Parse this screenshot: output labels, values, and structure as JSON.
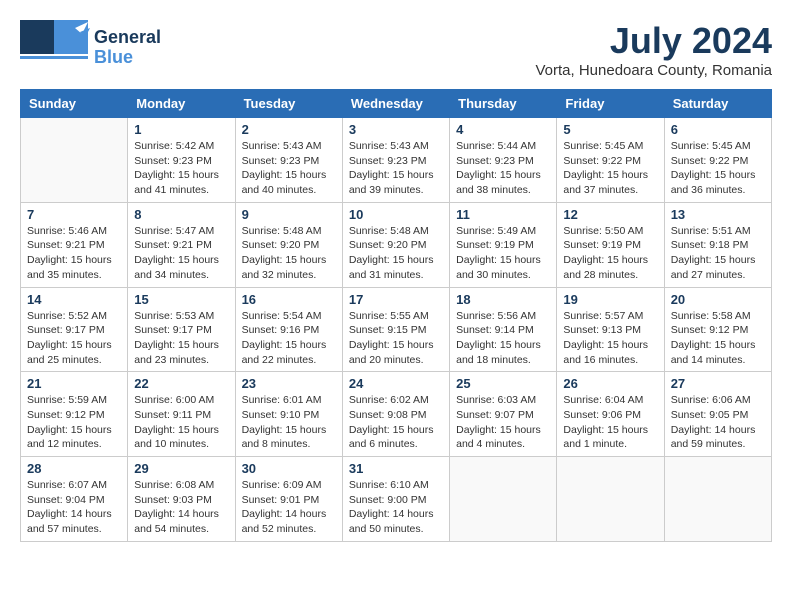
{
  "header": {
    "logo_line1": "General",
    "logo_line2": "Blue",
    "month": "July 2024",
    "location": "Vorta, Hunedoara County, Romania"
  },
  "days_of_week": [
    "Sunday",
    "Monday",
    "Tuesday",
    "Wednesday",
    "Thursday",
    "Friday",
    "Saturday"
  ],
  "weeks": [
    [
      {
        "day": "",
        "sunrise": "",
        "sunset": "",
        "daylight": ""
      },
      {
        "day": "1",
        "sunrise": "Sunrise: 5:42 AM",
        "sunset": "Sunset: 9:23 PM",
        "daylight": "Daylight: 15 hours and 41 minutes."
      },
      {
        "day": "2",
        "sunrise": "Sunrise: 5:43 AM",
        "sunset": "Sunset: 9:23 PM",
        "daylight": "Daylight: 15 hours and 40 minutes."
      },
      {
        "day": "3",
        "sunrise": "Sunrise: 5:43 AM",
        "sunset": "Sunset: 9:23 PM",
        "daylight": "Daylight: 15 hours and 39 minutes."
      },
      {
        "day": "4",
        "sunrise": "Sunrise: 5:44 AM",
        "sunset": "Sunset: 9:23 PM",
        "daylight": "Daylight: 15 hours and 38 minutes."
      },
      {
        "day": "5",
        "sunrise": "Sunrise: 5:45 AM",
        "sunset": "Sunset: 9:22 PM",
        "daylight": "Daylight: 15 hours and 37 minutes."
      },
      {
        "day": "6",
        "sunrise": "Sunrise: 5:45 AM",
        "sunset": "Sunset: 9:22 PM",
        "daylight": "Daylight: 15 hours and 36 minutes."
      }
    ],
    [
      {
        "day": "7",
        "sunrise": "Sunrise: 5:46 AM",
        "sunset": "Sunset: 9:21 PM",
        "daylight": "Daylight: 15 hours and 35 minutes."
      },
      {
        "day": "8",
        "sunrise": "Sunrise: 5:47 AM",
        "sunset": "Sunset: 9:21 PM",
        "daylight": "Daylight: 15 hours and 34 minutes."
      },
      {
        "day": "9",
        "sunrise": "Sunrise: 5:48 AM",
        "sunset": "Sunset: 9:20 PM",
        "daylight": "Daylight: 15 hours and 32 minutes."
      },
      {
        "day": "10",
        "sunrise": "Sunrise: 5:48 AM",
        "sunset": "Sunset: 9:20 PM",
        "daylight": "Daylight: 15 hours and 31 minutes."
      },
      {
        "day": "11",
        "sunrise": "Sunrise: 5:49 AM",
        "sunset": "Sunset: 9:19 PM",
        "daylight": "Daylight: 15 hours and 30 minutes."
      },
      {
        "day": "12",
        "sunrise": "Sunrise: 5:50 AM",
        "sunset": "Sunset: 9:19 PM",
        "daylight": "Daylight: 15 hours and 28 minutes."
      },
      {
        "day": "13",
        "sunrise": "Sunrise: 5:51 AM",
        "sunset": "Sunset: 9:18 PM",
        "daylight": "Daylight: 15 hours and 27 minutes."
      }
    ],
    [
      {
        "day": "14",
        "sunrise": "Sunrise: 5:52 AM",
        "sunset": "Sunset: 9:17 PM",
        "daylight": "Daylight: 15 hours and 25 minutes."
      },
      {
        "day": "15",
        "sunrise": "Sunrise: 5:53 AM",
        "sunset": "Sunset: 9:17 PM",
        "daylight": "Daylight: 15 hours and 23 minutes."
      },
      {
        "day": "16",
        "sunrise": "Sunrise: 5:54 AM",
        "sunset": "Sunset: 9:16 PM",
        "daylight": "Daylight: 15 hours and 22 minutes."
      },
      {
        "day": "17",
        "sunrise": "Sunrise: 5:55 AM",
        "sunset": "Sunset: 9:15 PM",
        "daylight": "Daylight: 15 hours and 20 minutes."
      },
      {
        "day": "18",
        "sunrise": "Sunrise: 5:56 AM",
        "sunset": "Sunset: 9:14 PM",
        "daylight": "Daylight: 15 hours and 18 minutes."
      },
      {
        "day": "19",
        "sunrise": "Sunrise: 5:57 AM",
        "sunset": "Sunset: 9:13 PM",
        "daylight": "Daylight: 15 hours and 16 minutes."
      },
      {
        "day": "20",
        "sunrise": "Sunrise: 5:58 AM",
        "sunset": "Sunset: 9:12 PM",
        "daylight": "Daylight: 15 hours and 14 minutes."
      }
    ],
    [
      {
        "day": "21",
        "sunrise": "Sunrise: 5:59 AM",
        "sunset": "Sunset: 9:12 PM",
        "daylight": "Daylight: 15 hours and 12 minutes."
      },
      {
        "day": "22",
        "sunrise": "Sunrise: 6:00 AM",
        "sunset": "Sunset: 9:11 PM",
        "daylight": "Daylight: 15 hours and 10 minutes."
      },
      {
        "day": "23",
        "sunrise": "Sunrise: 6:01 AM",
        "sunset": "Sunset: 9:10 PM",
        "daylight": "Daylight: 15 hours and 8 minutes."
      },
      {
        "day": "24",
        "sunrise": "Sunrise: 6:02 AM",
        "sunset": "Sunset: 9:08 PM",
        "daylight": "Daylight: 15 hours and 6 minutes."
      },
      {
        "day": "25",
        "sunrise": "Sunrise: 6:03 AM",
        "sunset": "Sunset: 9:07 PM",
        "daylight": "Daylight: 15 hours and 4 minutes."
      },
      {
        "day": "26",
        "sunrise": "Sunrise: 6:04 AM",
        "sunset": "Sunset: 9:06 PM",
        "daylight": "Daylight: 15 hours and 1 minute."
      },
      {
        "day": "27",
        "sunrise": "Sunrise: 6:06 AM",
        "sunset": "Sunset: 9:05 PM",
        "daylight": "Daylight: 14 hours and 59 minutes."
      }
    ],
    [
      {
        "day": "28",
        "sunrise": "Sunrise: 6:07 AM",
        "sunset": "Sunset: 9:04 PM",
        "daylight": "Daylight: 14 hours and 57 minutes."
      },
      {
        "day": "29",
        "sunrise": "Sunrise: 6:08 AM",
        "sunset": "Sunset: 9:03 PM",
        "daylight": "Daylight: 14 hours and 54 minutes."
      },
      {
        "day": "30",
        "sunrise": "Sunrise: 6:09 AM",
        "sunset": "Sunset: 9:01 PM",
        "daylight": "Daylight: 14 hours and 52 minutes."
      },
      {
        "day": "31",
        "sunrise": "Sunrise: 6:10 AM",
        "sunset": "Sunset: 9:00 PM",
        "daylight": "Daylight: 14 hours and 50 minutes."
      },
      {
        "day": "",
        "sunrise": "",
        "sunset": "",
        "daylight": ""
      },
      {
        "day": "",
        "sunrise": "",
        "sunset": "",
        "daylight": ""
      },
      {
        "day": "",
        "sunrise": "",
        "sunset": "",
        "daylight": ""
      }
    ]
  ]
}
